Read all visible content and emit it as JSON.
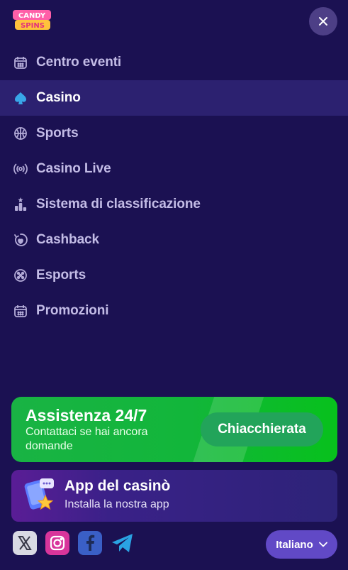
{
  "brand": {
    "logo_text_top": "CANDY",
    "logo_text_bottom": "SPINS"
  },
  "nav": {
    "items": [
      {
        "label": "Centro eventi",
        "icon": "calendar-icon",
        "active": false
      },
      {
        "label": "Casino",
        "icon": "spade-icon",
        "active": true
      },
      {
        "label": "Sports",
        "icon": "basketball-icon",
        "active": false
      },
      {
        "label": "Casino Live",
        "icon": "broadcast-icon",
        "active": false
      },
      {
        "label": "Sistema di classificazione",
        "icon": "ranking-icon",
        "active": false
      },
      {
        "label": "Cashback",
        "icon": "cashback-icon",
        "active": false
      },
      {
        "label": "Esports",
        "icon": "dice-icon",
        "active": false
      },
      {
        "label": "Promozioni",
        "icon": "calendar-icon",
        "active": false
      }
    ]
  },
  "support": {
    "title": "Assistenza 24/7",
    "subtitle": "Contattaci se hai ancora domande",
    "button_label": "Chiacchierata"
  },
  "app": {
    "title": "App del casinò",
    "subtitle": "Installa la nostra app"
  },
  "socials": [
    "x-icon",
    "instagram-icon",
    "facebook-icon",
    "telegram-icon"
  ],
  "language": {
    "selected": "Italiano"
  },
  "colors": {
    "background": "#1b1152",
    "active_row": "#2c2170",
    "support_green": "#12b63a",
    "language_button": "#6149c6",
    "close_button": "#4d3f86"
  }
}
